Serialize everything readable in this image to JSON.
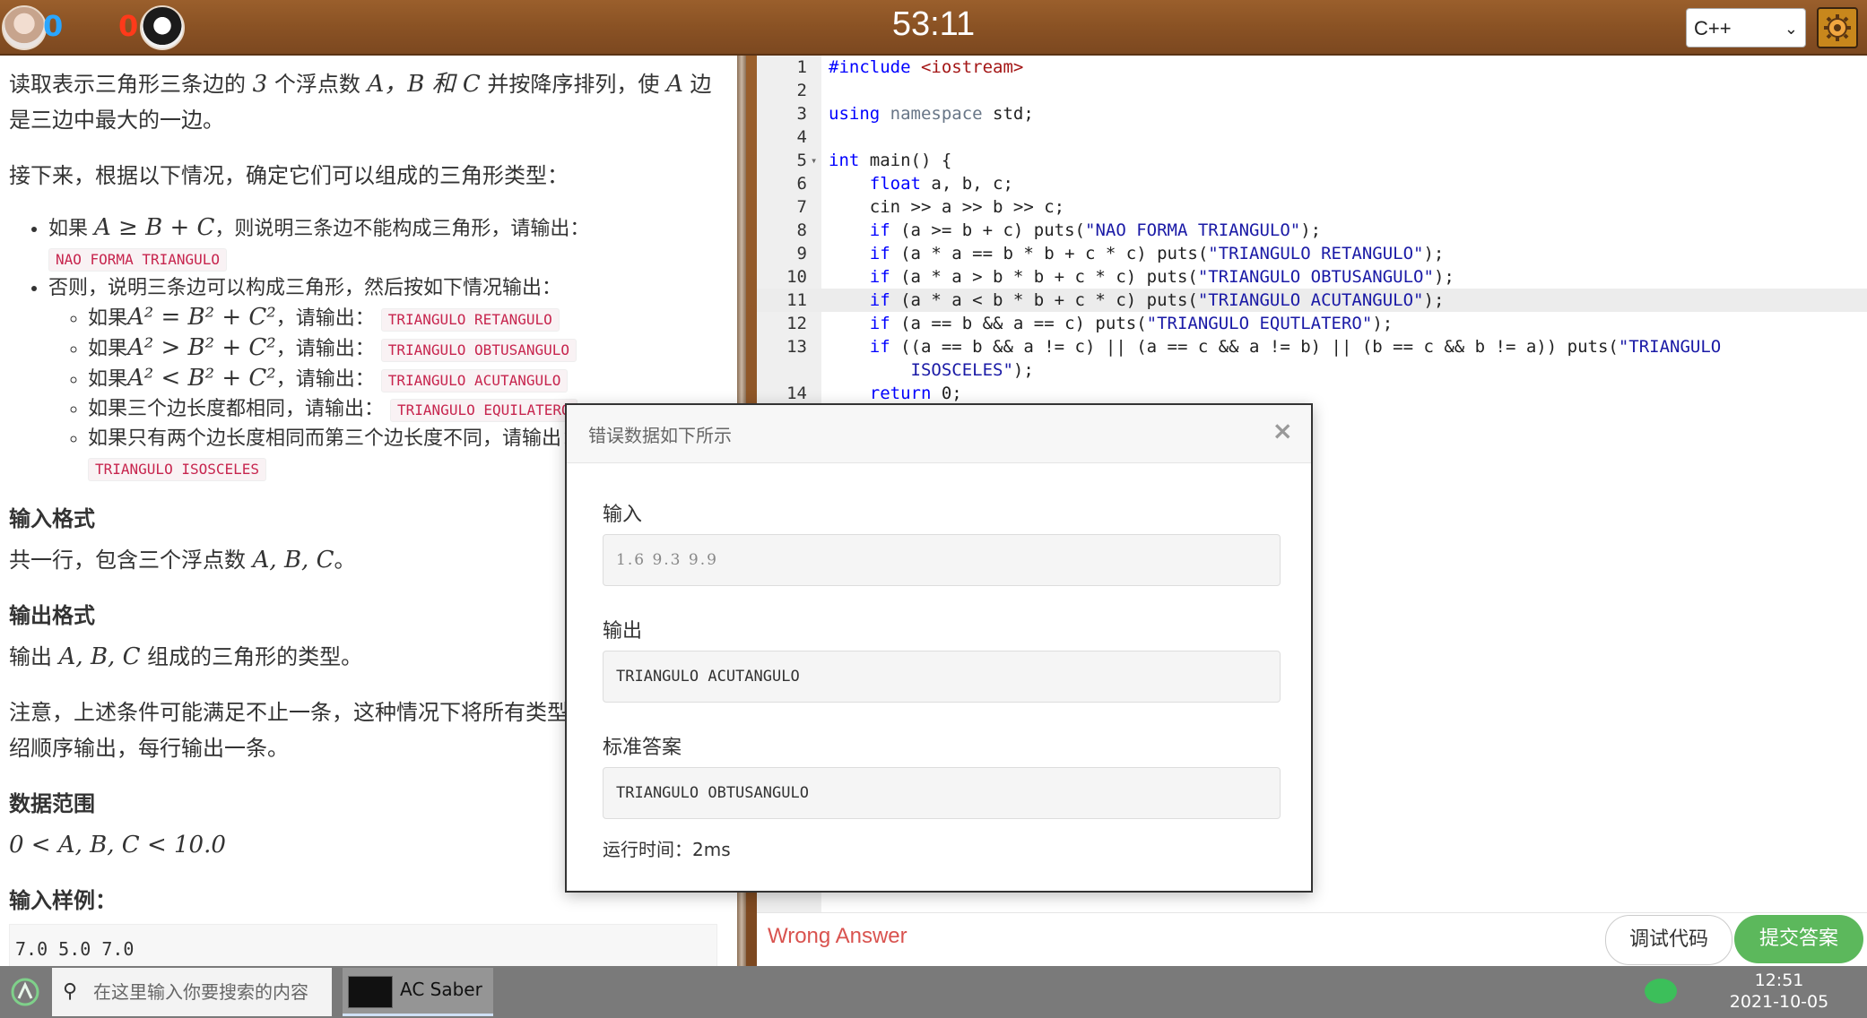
{
  "topbar": {
    "player1_score": "0",
    "player2_score": "0",
    "timer": "53:11",
    "language": "C++"
  },
  "problem": {
    "intro_1": "读取表示三角形三条边的",
    "intro_num": "3",
    "intro_2": "个浮点数",
    "intro_vars": "A，B 和 C",
    "intro_3": "并按降序排列，使",
    "intro_var_a": "A",
    "intro_4": "边是三边中最大的一边。",
    "next_line": "接下来，根据以下情况，确定它们可以组成的三角形类型：",
    "cond1_text": "如果",
    "cond1_math": "A ≥ B + C",
    "cond1_tail": "，则说明三条边不能构成三角形，请输出：",
    "cond1_output": "NAO FORMA TRIANGULO",
    "cond2_text": "否则，说明三条边可以构成三角形，然后按如下情况输出：",
    "sub_conditions": [
      {
        "prefix": "如果",
        "math": "A² = B² + C²",
        "suffix": "，请输出：",
        "output": "TRIANGULO RETANGULO"
      },
      {
        "prefix": "如果",
        "math": "A² > B² + C²",
        "suffix": "，请输出：",
        "output": "TRIANGULO OBTUSANGULO"
      },
      {
        "prefix": "如果",
        "math": "A² < B² + C²",
        "suffix": "，请输出：",
        "output": "TRIANGULO ACUTANGULO"
      },
      {
        "prefix": "如果三个边长度都相同，请输出：",
        "math": "",
        "suffix": "",
        "output": "TRIANGULO EQUILATERO"
      },
      {
        "prefix": "如果只有两个边长度相同而第三个边长度不同，请输出：",
        "math": "",
        "suffix": "",
        "output": "TRIANGULO ISOSCELES"
      }
    ],
    "input_format_title": "输入格式",
    "input_format_text": "共一行，包含三个浮点数",
    "input_format_math": "A, B, C",
    "input_format_end": "。",
    "output_format_title": "输出格式",
    "output_format_text": "输出",
    "output_format_math": "A, B, C",
    "output_format_end": "组成的三角形的类型。",
    "note_line1": "注意，上述条件可能满足不止一条，这种情况下将所有类型",
    "note_line2": "绍顺序输出，每行输出一条。",
    "range_title": "数据范围",
    "range_math": "0 < A, B, C < 10.0",
    "sample_title": "输入样例：",
    "sample_value": "7.0 5.0 7.0"
  },
  "editor": {
    "lines": [
      {
        "n": "1"
      },
      {
        "n": "2"
      },
      {
        "n": "3"
      },
      {
        "n": "4"
      },
      {
        "n": "5"
      },
      {
        "n": "6"
      },
      {
        "n": "7"
      },
      {
        "n": "8"
      },
      {
        "n": "9"
      },
      {
        "n": "10"
      },
      {
        "n": "11"
      },
      {
        "n": "12"
      },
      {
        "n": "13"
      },
      {
        "n": "14"
      }
    ],
    "code": {
      "l1_pp": "#include",
      "l1_inc": "<iostream>",
      "l3_kw": "using",
      "l3_ns": "namespace",
      "l3_rest": " std;",
      "l5_kw": "int",
      "l5_rest": " main() {",
      "l6_kw": "float",
      "l6_rest": " a, b, c;",
      "l7": "cin >> a >> b >> c;",
      "l8_kw": "if",
      "l8_cond": " (a >= b + c) puts(",
      "l8_str": "\"NAO FORMA TRIANGULO\"",
      "l8_end": ");",
      "l9_kw": "if",
      "l9_cond": " (a * a == b * b + c * c) puts(",
      "l9_str": "\"TRIANGULO RETANGULO\"",
      "l9_end": ");",
      "l10_kw": "if",
      "l10_cond": " (a * a > b * b + c * c) puts(",
      "l10_str": "\"TRIANGULO OBTUSANGULO\"",
      "l10_end": ");",
      "l11_kw": "if",
      "l11_cond": " (a * a < b * b + c * c) puts(",
      "l11_str": "\"TRIANGULO ACUTANGULO\"",
      "l11_end": ");",
      "l12_kw": "if",
      "l12_cond": " (a == b && a == c) puts(",
      "l12_str": "\"TRIANGULO EQUTLATERO\"",
      "l12_end": ");",
      "l13_kw": "if",
      "l13_cond": " ((a == b && a != c) || (a == c && a != b) || (b == c && b != a)) puts(",
      "l13_str": "\"TRIANGULO",
      "l13b_str": "ISOSCELES\"",
      "l13b_end": ");",
      "l14_kw": "return",
      "l14_rest": " 0;"
    }
  },
  "status": {
    "verdict": "Wrong Answer",
    "debug_label": "调试代码",
    "submit_label": "提交答案",
    "verdict_color": "#d9534f",
    "submit_color": "#5cb85c"
  },
  "modal": {
    "title": "错误数据如下所示",
    "close": "×",
    "input_label": "输入",
    "input_value": "1.6 9.3 9.9",
    "output_label": "输出",
    "output_value": "TRIANGULO ACUTANGULO",
    "expected_label": "标准答案",
    "expected_value": "TRIANGULO OBTUSANGULO",
    "runtime": "运行时间：2ms"
  },
  "taskbar": {
    "search_placeholder": "在这里输入你要搜索的内容",
    "app_label": "AC Saber",
    "time": "12:51",
    "date": "2021-10-05"
  }
}
